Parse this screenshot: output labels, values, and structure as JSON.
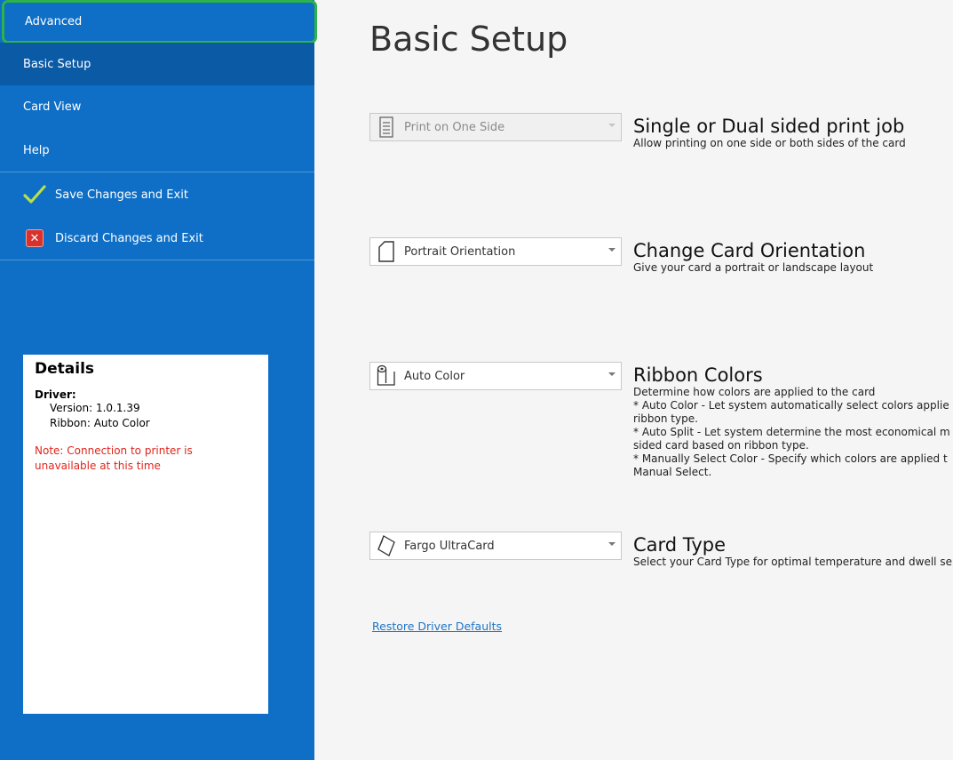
{
  "sidebar": {
    "nav": [
      {
        "label": "Advanced"
      },
      {
        "label": "Basic Setup"
      },
      {
        "label": "Card View"
      },
      {
        "label": "Help"
      }
    ],
    "actions": [
      {
        "label": "Save Changes and Exit",
        "icon": "checkmark-icon"
      },
      {
        "label": "Discard Changes and Exit",
        "icon": "close-icon"
      }
    ]
  },
  "details": {
    "title": "Details",
    "driver_label": "Driver:",
    "version": "Version: 1.0.1.39",
    "ribbon": "Ribbon: Auto Color",
    "note": "Note: Connection to printer is unavailable at this time"
  },
  "main": {
    "title": "Basic Setup",
    "settings": [
      {
        "dropdown_value": "Print on One Side",
        "heading": "Single or Dual sided print job",
        "description": "Allow printing on one side or both sides of the card",
        "icon": "document-icon"
      },
      {
        "dropdown_value": "Portrait Orientation",
        "heading": "Change Card Orientation",
        "description": "Give your card a portrait or landscape layout",
        "icon": "portrait-card-icon"
      },
      {
        "dropdown_value": "Auto Color",
        "heading": "Ribbon Colors",
        "description": "Determine how colors are applied to the card\n* Auto Color - Let system automatically select colors applie\nribbon type.\n* Auto Split - Let system determine the most economical m\nsided card based on ribbon type.\n* Manually Select Color - Specify which colors are applied t\nManual Select.",
        "icon": "ribbon-roll-icon"
      },
      {
        "dropdown_value": "Fargo UltraCard",
        "heading": "Card Type",
        "description": "Select your Card Type for optimal temperature and dwell se",
        "icon": "card-type-icon"
      }
    ],
    "restore_link": "Restore Driver Defaults"
  },
  "colors": {
    "sidebar": "#0f6fc6",
    "sidebar_active": "#0b5aa6",
    "highlight": "#2db34a",
    "note": "#e0241b",
    "link": "#1f74c6"
  }
}
